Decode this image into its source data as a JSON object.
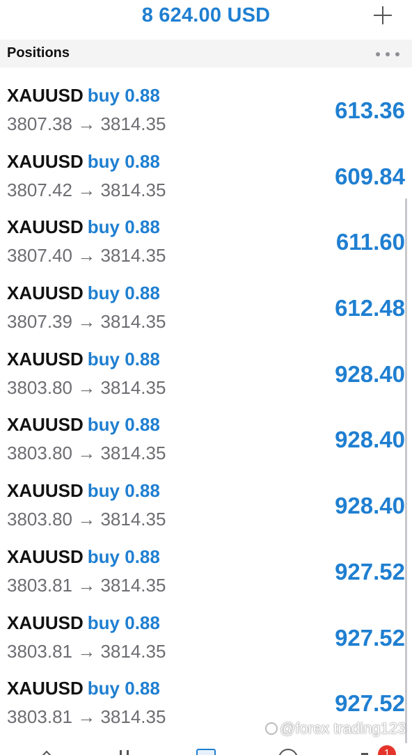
{
  "header": {
    "balance": "8 624.00 USD",
    "add_icon": "plus-icon"
  },
  "section": {
    "title": "Positions",
    "menu_icon": "more-horizontal-icon"
  },
  "positions": [
    {
      "symbol": "XAUUSD",
      "side": "buy 0.88",
      "open": "3807.38",
      "current": "3814.35",
      "profit": "613.36"
    },
    {
      "symbol": "XAUUSD",
      "side": "buy 0.88",
      "open": "3807.42",
      "current": "3814.35",
      "profit": "609.84"
    },
    {
      "symbol": "XAUUSD",
      "side": "buy 0.88",
      "open": "3807.40",
      "current": "3814.35",
      "profit": "611.60"
    },
    {
      "symbol": "XAUUSD",
      "side": "buy 0.88",
      "open": "3807.39",
      "current": "3814.35",
      "profit": "612.48"
    },
    {
      "symbol": "XAUUSD",
      "side": "buy 0.88",
      "open": "3803.80",
      "current": "3814.35",
      "profit": "928.40"
    },
    {
      "symbol": "XAUUSD",
      "side": "buy 0.88",
      "open": "3803.80",
      "current": "3814.35",
      "profit": "928.40"
    },
    {
      "symbol": "XAUUSD",
      "side": "buy 0.88",
      "open": "3803.80",
      "current": "3814.35",
      "profit": "928.40"
    },
    {
      "symbol": "XAUUSD",
      "side": "buy 0.88",
      "open": "3803.81",
      "current": "3814.35",
      "profit": "927.52"
    },
    {
      "symbol": "XAUUSD",
      "side": "buy 0.88",
      "open": "3803.81",
      "current": "3814.35",
      "profit": "927.52"
    },
    {
      "symbol": "XAUUSD",
      "side": "buy 0.88",
      "open": "3803.81",
      "current": "3814.35",
      "profit": "927.52"
    }
  ],
  "arrow": "→",
  "watermark": "@forex trading123",
  "tabbar": {
    "icons": [
      "quotes-icon",
      "chart-icon",
      "trade-icon",
      "history-icon",
      "messages-icon"
    ],
    "badge": "1"
  },
  "colors": {
    "accent": "#1f7fd1",
    "badge": "#e5342b"
  }
}
